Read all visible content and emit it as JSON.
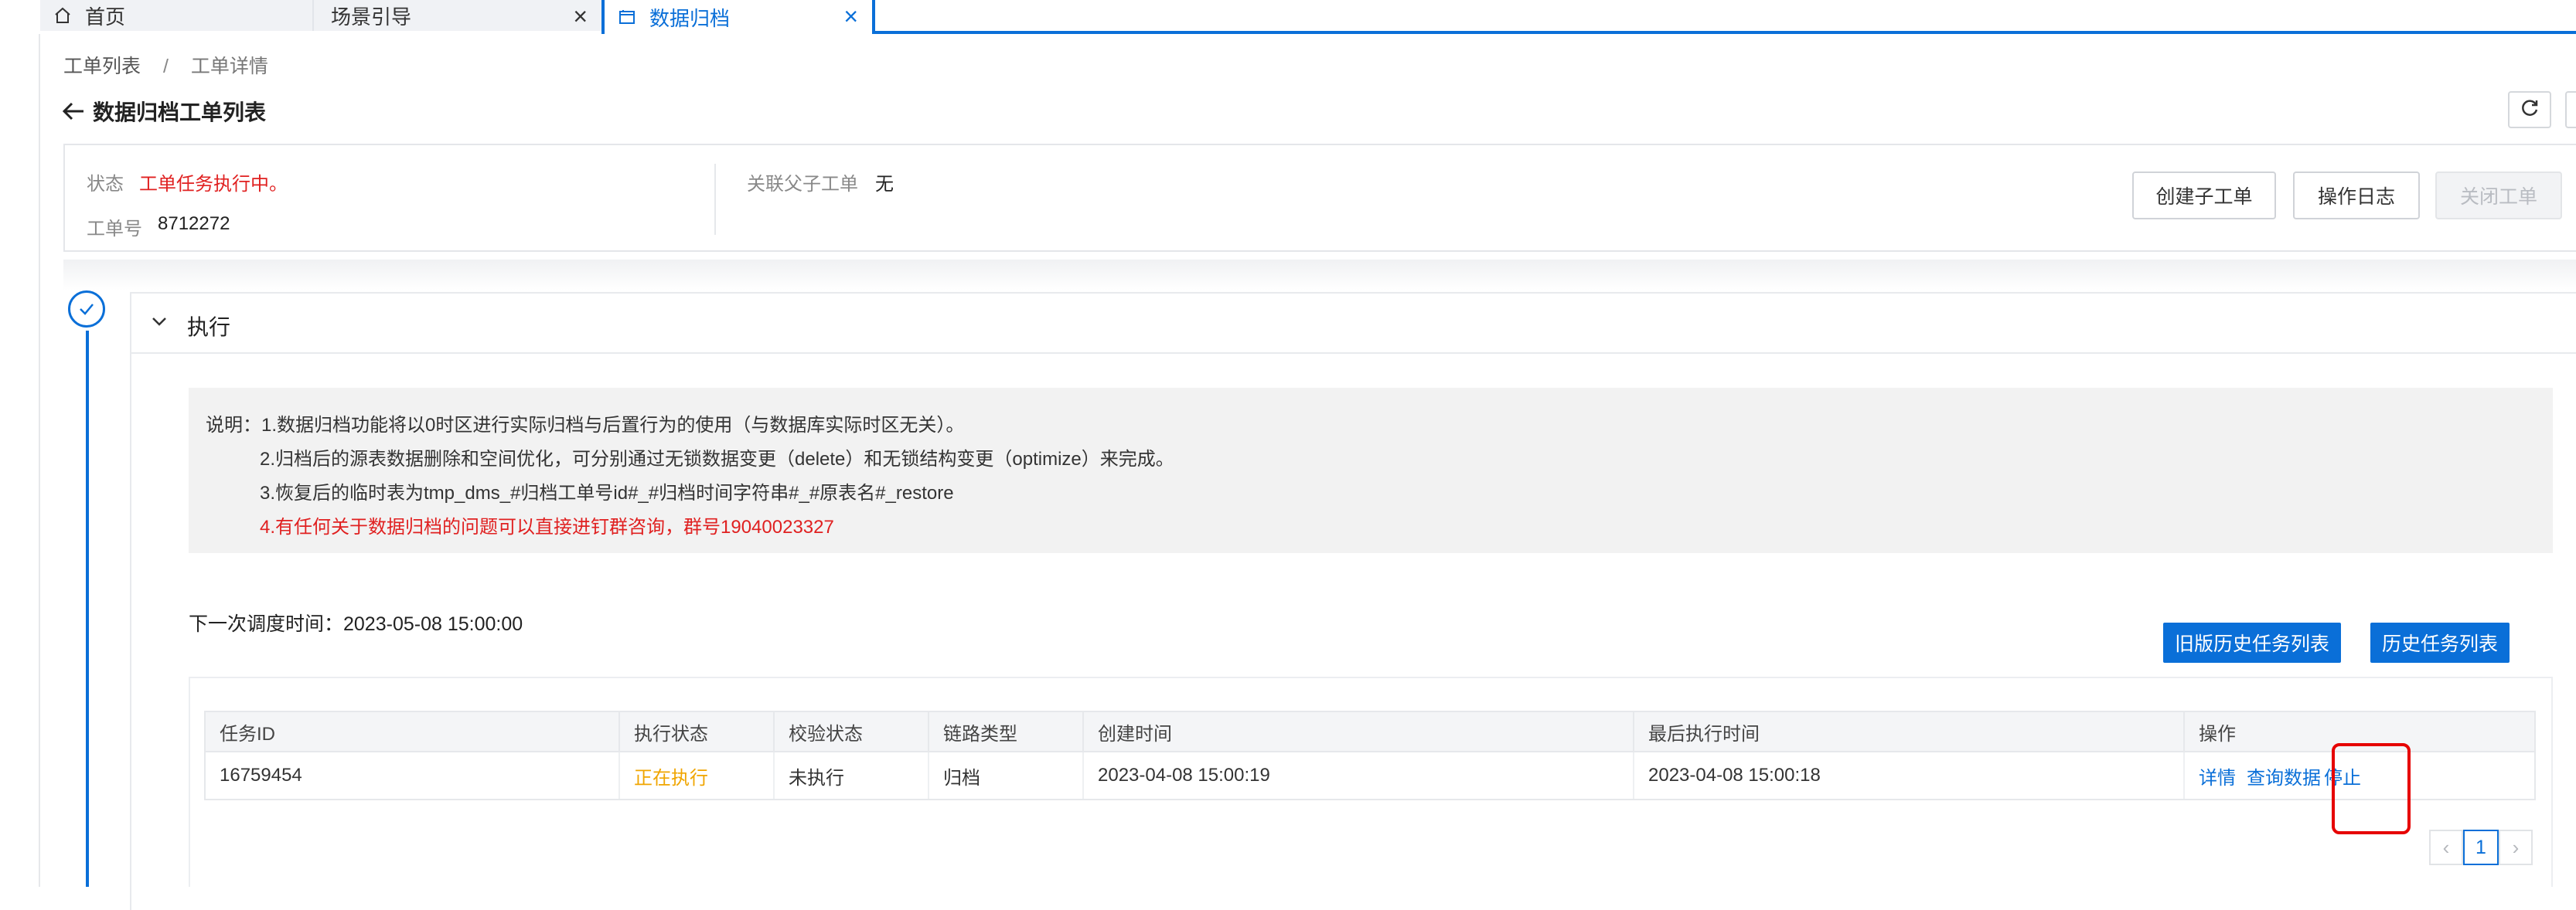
{
  "tabs": [
    {
      "label": "首页",
      "icon": "home-icon"
    },
    {
      "label": "场景引导",
      "close": "×"
    },
    {
      "label": "数据归档",
      "icon": "window-icon",
      "close": "×",
      "active": true
    }
  ],
  "breadcrumb": {
    "items": [
      "工单列表",
      "工单详情"
    ],
    "separator": "/"
  },
  "page_title": "数据归档工单列表",
  "info": {
    "status_label": "状态",
    "status_value": "工单任务执行中。",
    "ticket_label": "工单号",
    "ticket_value": "8712272",
    "parent_label": "关联父子工单",
    "parent_value": "无"
  },
  "actions": {
    "create_child": "创建子工单",
    "operation_log": "操作日志",
    "close_ticket": "关闭工单"
  },
  "step": {
    "title": "执行"
  },
  "notice": {
    "line1": "说明：1.数据归档功能将以0时区进行实际归档与后置行为的使用（与数据库实际时区无关）。",
    "line2": "2.归档后的源表数据删除和空间优化，可分别通过无锁数据变更（delete）和无锁结构变更（optimize）来完成。",
    "line3": "3.恢复后的临时表为tmp_dms_#归档工单号id#_#归档时间字符串#_#原表名#_restore",
    "line4": "4.有任何关于数据归档的问题可以直接进钉群咨询，群号19040023327"
  },
  "schedule": {
    "text": "下一次调度时间：2023-05-08 15:00:00"
  },
  "buttons": {
    "old_history": "旧版历史任务列表",
    "history": "历史任务列表"
  },
  "table": {
    "headers": [
      "任务ID",
      "执行状态",
      "校验状态",
      "链路类型",
      "创建时间",
      "最后执行时间",
      "操作"
    ],
    "rows": [
      {
        "task_id": "16759454",
        "exec_status": "正在执行",
        "check_status": "未执行",
        "link_type": "归档",
        "created": "2023-04-08 15:00:19",
        "last_exec": "2023-04-08 15:00:18",
        "ops": [
          "详情",
          "查询数据",
          "停止"
        ]
      }
    ]
  },
  "pagination": {
    "prev": "‹",
    "current": "1",
    "next": "›"
  },
  "colors": {
    "accent": "#0a6fd8",
    "danger": "#e02020",
    "warning": "#f0a500",
    "highlight_box": "#e60000"
  }
}
